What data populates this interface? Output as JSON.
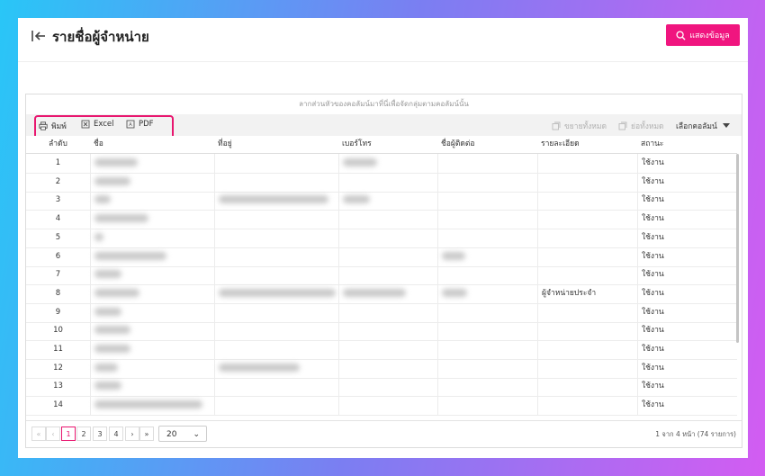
{
  "header": {
    "title": "รายชื่อผู้จำหน่าย",
    "show_button": "แสดงข้อมูล"
  },
  "grid": {
    "group_hint": "ลากส่วนหัวของคอลัมน์มาที่นี่เพื่อจัดกลุ่มตามคอลัมน์นั้น",
    "toolbar": {
      "print": "พิมพ์",
      "excel": "Excel",
      "pdf": "PDF",
      "expand_all": "ขยายทั้งหมด",
      "collapse_all": "ย่อทั้งหมด",
      "choose_columns": "เลือกคอลัมน์"
    },
    "columns": [
      "ลำดับ",
      "ชื่อ",
      "ที่อยู่",
      "เบอร์โทร",
      "ชื่อผู้ติดต่อ",
      "รายละเอียด",
      "สถานะ"
    ],
    "rows": [
      {
        "no": "1",
        "name_blur": true,
        "address_blur": false,
        "phone_blur": true,
        "contact_blur": false,
        "detail": "",
        "status": "ใช้งาน"
      },
      {
        "no": "2",
        "name_blur": true,
        "address_blur": false,
        "phone_blur": false,
        "contact_blur": false,
        "detail": "",
        "status": "ใช้งาน"
      },
      {
        "no": "3",
        "name_blur": true,
        "address_blur": true,
        "phone_blur": true,
        "contact_blur": false,
        "detail": "",
        "status": "ใช้งาน"
      },
      {
        "no": "4",
        "name_blur": true,
        "address_blur": false,
        "phone_blur": false,
        "contact_blur": false,
        "detail": "",
        "status": "ใช้งาน"
      },
      {
        "no": "5",
        "name_blur": true,
        "address_blur": false,
        "phone_blur": false,
        "contact_blur": false,
        "detail": "",
        "status": "ใช้งาน"
      },
      {
        "no": "6",
        "name_blur": true,
        "address_blur": false,
        "phone_blur": false,
        "contact_blur": true,
        "detail": "",
        "status": "ใช้งาน"
      },
      {
        "no": "7",
        "name_blur": true,
        "address_blur": false,
        "phone_blur": false,
        "contact_blur": false,
        "detail": "",
        "status": "ใช้งาน"
      },
      {
        "no": "8",
        "name_blur": true,
        "address_blur": true,
        "phone_blur": true,
        "contact_blur": true,
        "detail": "ผู้จำหน่ายประจำ",
        "status": "ใช้งาน"
      },
      {
        "no": "9",
        "name_blur": true,
        "address_blur": false,
        "phone_blur": false,
        "contact_blur": false,
        "detail": "",
        "status": "ใช้งาน"
      },
      {
        "no": "10",
        "name_blur": true,
        "address_blur": false,
        "phone_blur": false,
        "contact_blur": false,
        "detail": "",
        "status": "ใช้งาน"
      },
      {
        "no": "11",
        "name_blur": true,
        "address_blur": false,
        "phone_blur": false,
        "contact_blur": false,
        "detail": "",
        "status": "ใช้งาน"
      },
      {
        "no": "12",
        "name_blur": true,
        "address_blur": true,
        "phone_blur": false,
        "contact_blur": false,
        "detail": "",
        "status": "ใช้งาน"
      },
      {
        "no": "13",
        "name_blur": true,
        "address_blur": false,
        "phone_blur": false,
        "contact_blur": false,
        "detail": "",
        "status": "ใช้งาน"
      },
      {
        "no": "14",
        "name_blur": true,
        "address_blur": false,
        "phone_blur": false,
        "contact_blur": false,
        "detail": "",
        "status": "ใช้งาน"
      }
    ]
  },
  "pager": {
    "first": "«",
    "prev": "‹",
    "pages": [
      "1",
      "2",
      "3",
      "4"
    ],
    "current_page": "1",
    "next": "›",
    "last": "»",
    "page_size": "20",
    "info": "1 จาก 4 หน้า (74 รายการ)"
  },
  "colors": {
    "accent": "#f0157f",
    "highlight_border": "#e8166f"
  }
}
